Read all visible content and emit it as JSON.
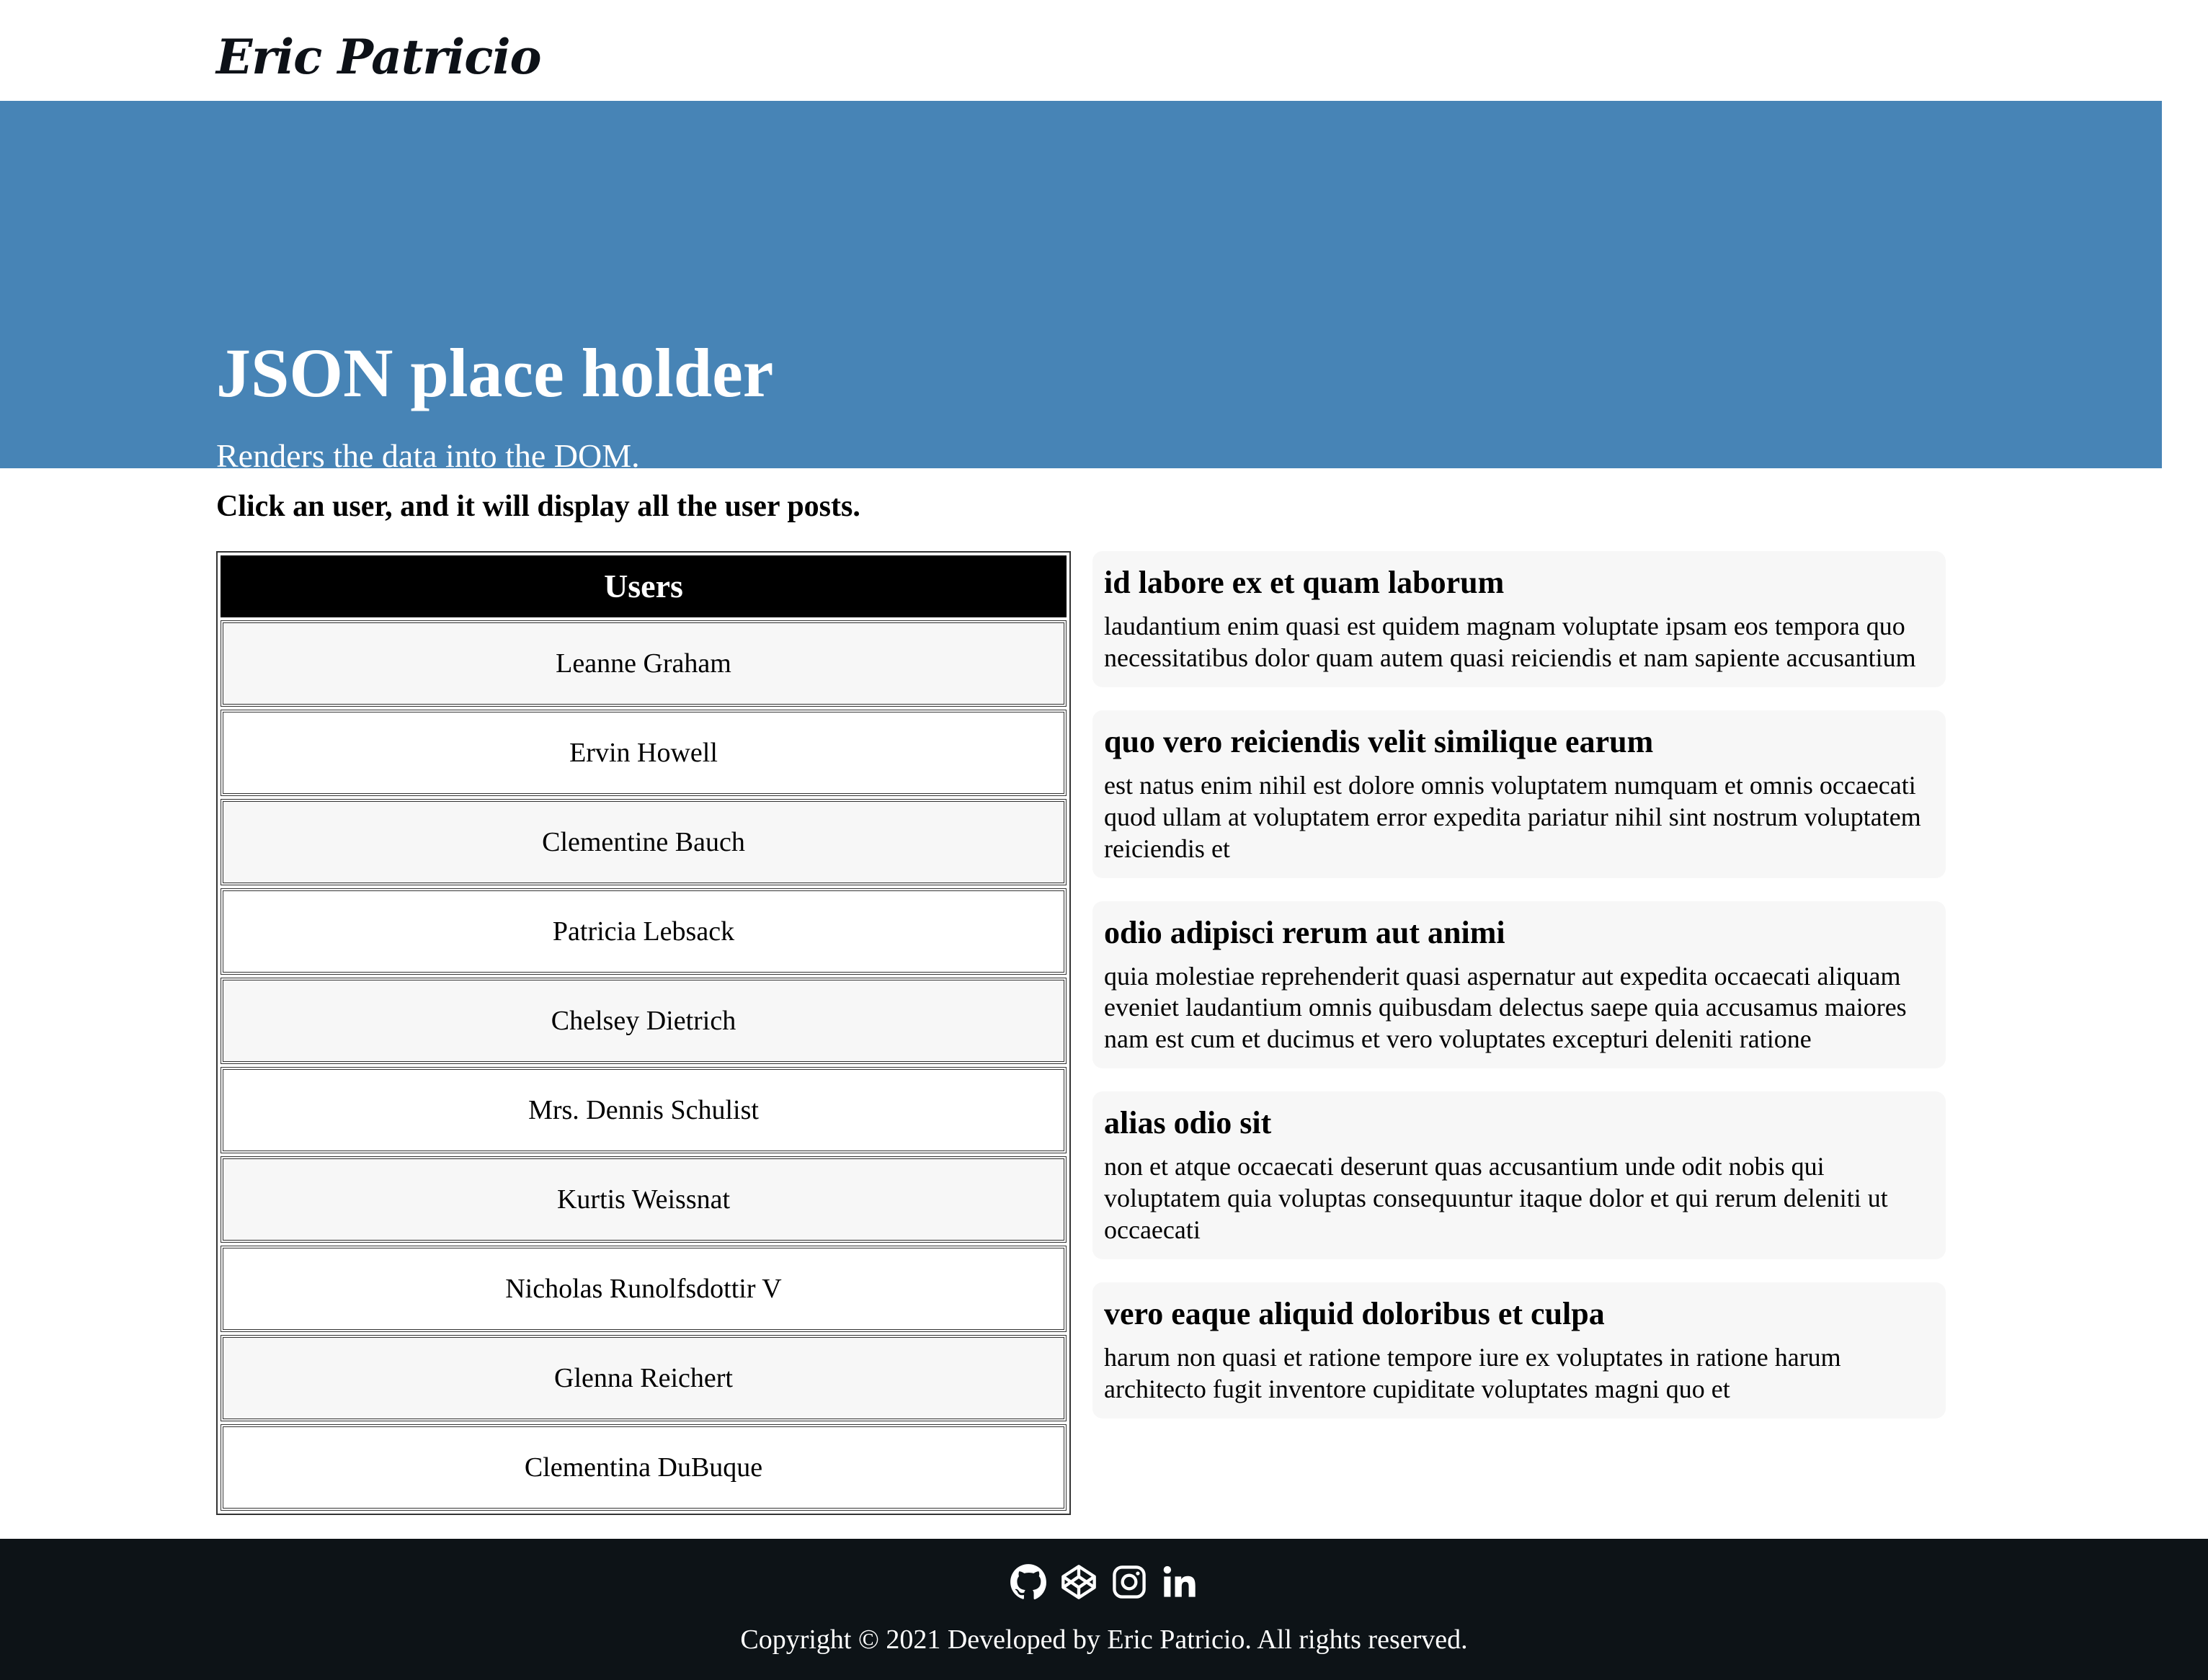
{
  "nav": {
    "brand": "Eric Patricio"
  },
  "hero": {
    "title": "JSON place holder",
    "subtitle": "Renders the data into the DOM."
  },
  "main": {
    "instruction": "Click an user, and it will display all the user posts.",
    "users_header": "Users",
    "users": [
      "Leanne Graham",
      "Ervin Howell",
      "Clementine Bauch",
      "Patricia Lebsack",
      "Chelsey Dietrich",
      "Mrs. Dennis Schulist",
      "Kurtis Weissnat",
      "Nicholas Runolfsdottir V",
      "Glenna Reichert",
      "Clementina DuBuque"
    ],
    "posts": [
      {
        "title": "id labore ex et quam laborum",
        "body": "laudantium enim quasi est quidem magnam voluptate ipsam eos tempora quo necessitatibus dolor quam autem quasi reiciendis et nam sapiente accusantium"
      },
      {
        "title": "quo vero reiciendis velit similique earum",
        "body": "est natus enim nihil est dolore omnis voluptatem numquam et omnis occaecati quod ullam at voluptatem error expedita pariatur nihil sint nostrum voluptatem reiciendis et"
      },
      {
        "title": "odio adipisci rerum aut animi",
        "body": "quia molestiae reprehenderit quasi aspernatur aut expedita occaecati aliquam eveniet laudantium omnis quibusdam delectus saepe quia accusamus maiores nam est cum et ducimus et vero voluptates excepturi deleniti ratione"
      },
      {
        "title": "alias odio sit",
        "body": "non et atque occaecati deserunt quas accusantium unde odit nobis qui voluptatem quia voluptas consequuntur itaque dolor et qui rerum deleniti ut occaecati"
      },
      {
        "title": "vero eaque aliquid doloribus et culpa",
        "body": "harum non quasi et ratione tempore iure ex voluptates in ratione harum architecto fugit inventore cupiditate voluptates magni quo et"
      }
    ]
  },
  "footer": {
    "icons": [
      "github-icon",
      "codepen-icon",
      "instagram-icon",
      "linkedin-icon"
    ],
    "copyright": "Copyright © 2021 Developed by Eric Patricio. All rights reserved."
  },
  "colors": {
    "hero_bg": "#4784b6",
    "footer_bg": "#0d1317",
    "users_header_bg": "#000000",
    "post_bg": "#f7f7f7"
  }
}
